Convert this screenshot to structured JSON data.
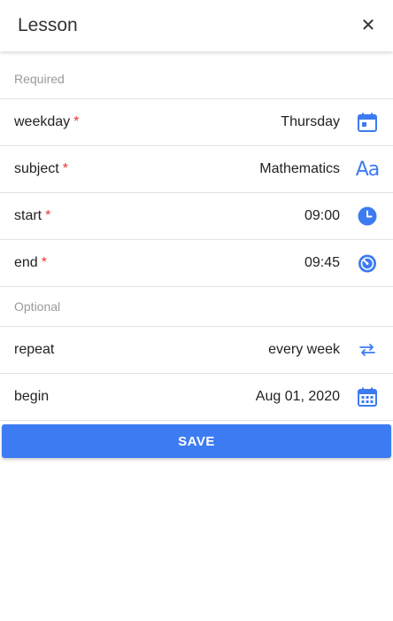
{
  "header": {
    "title": "Lesson",
    "close_glyph": "✕"
  },
  "sections": {
    "required": "Required",
    "optional": "Optional"
  },
  "required_marker": "*",
  "fields": {
    "weekday": {
      "label": "weekday",
      "value": "Thursday",
      "icon": "calendar-icon"
    },
    "subject": {
      "label": "subject",
      "value": "Mathematics",
      "icon": "font-icon",
      "icon_text": "Aa"
    },
    "start": {
      "label": "start",
      "value": "09:00",
      "icon": "clock-icon"
    },
    "end": {
      "label": "end",
      "value": "09:45",
      "icon": "timer-icon"
    },
    "repeat": {
      "label": "repeat",
      "value": "every week",
      "icon": "repeat-icon"
    },
    "begin": {
      "label": "begin",
      "value": "Aug 01, 2020",
      "icon": "calendar-month-icon"
    }
  },
  "save_label": "SAVE",
  "colors": {
    "accent": "#3d7bf2",
    "required": "#e53935",
    "section_text": "#9a9a9a",
    "divider": "#e2e2e2"
  }
}
